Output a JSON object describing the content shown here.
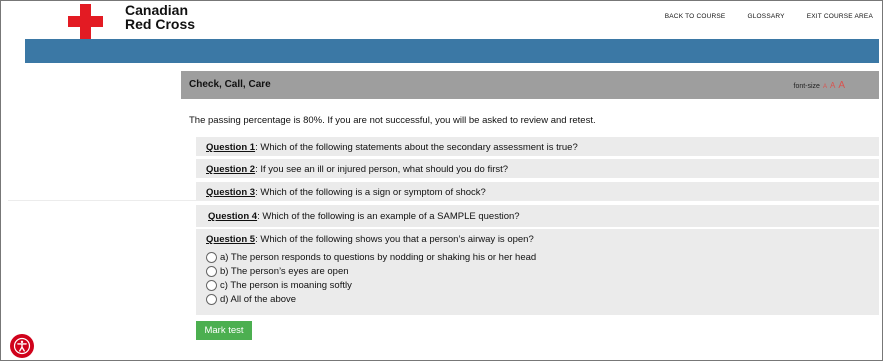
{
  "header": {
    "brand_line1": "Canadian",
    "brand_line2": "Red Cross",
    "nav": [
      "BACK TO COURSE",
      "GLOSSARY",
      "EXIT COURSE AREA"
    ]
  },
  "colors": {
    "brand_red": "#e31b23",
    "blue_bar": "#3b78a5",
    "title_bar": "#9e9e9e",
    "mark_button": "#4caf50",
    "a11y_button": "#d0021b"
  },
  "page": {
    "title": "Check, Call, Care",
    "font_size_label": "font-size",
    "font_size_options": [
      "A",
      "A",
      "A"
    ],
    "intro": "The passing percentage is 80%. If you are not successful, you will be asked to review and retest."
  },
  "questions": [
    {
      "label": "Question 1",
      "text": ": Which of the following statements about the secondary assessment is true?"
    },
    {
      "label": "Question 2",
      "text": ": If you see an ill or injured person, what should you do first?"
    },
    {
      "label": "Question 3",
      "text": ": Which of the following is a sign or symptom of shock?"
    },
    {
      "label": "Question 4",
      "text": ": Which of the following is an example of a SAMPLE question?"
    },
    {
      "label": "Question 5",
      "text": ": Which of the following shows you that a person’s airway is open?",
      "options": [
        "a) The person responds to questions by nodding or shaking his or her head",
        "b) The person’s eyes are open",
        "c) The person is moaning softly",
        "d) All of the above"
      ]
    }
  ],
  "actions": {
    "mark_test": "Mark test"
  },
  "icons": {
    "logo": "red-cross-icon",
    "accessibility": "accessibility-icon"
  }
}
